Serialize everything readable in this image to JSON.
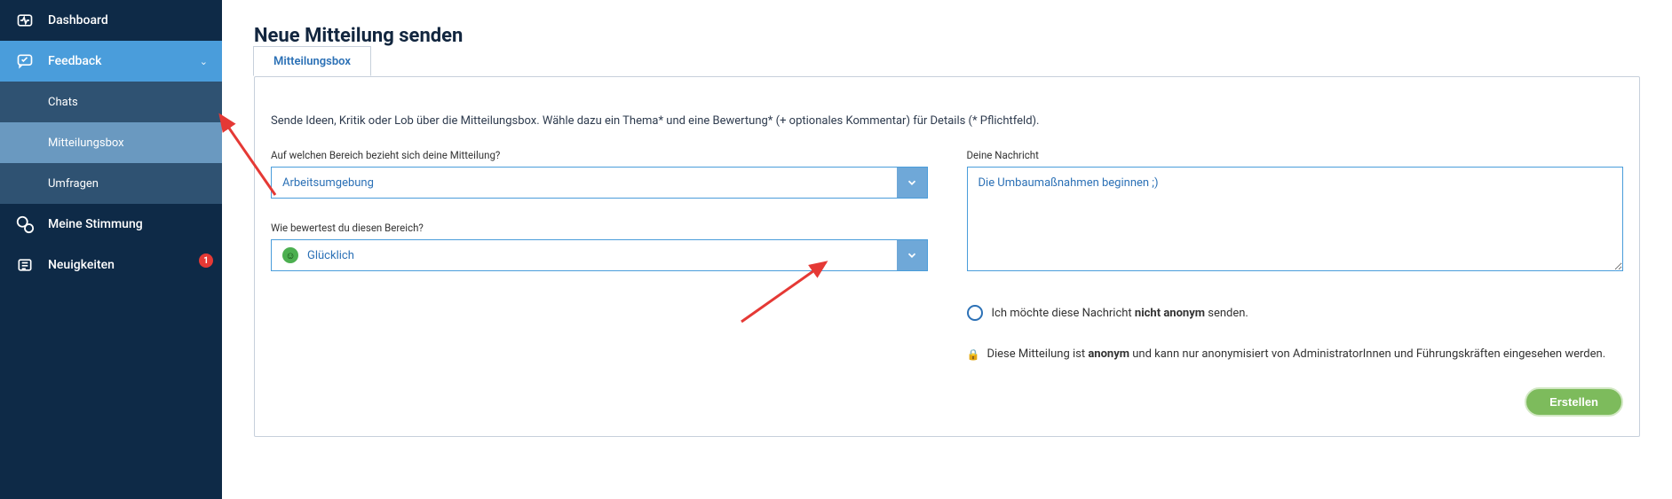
{
  "sidebar": {
    "dashboard": "Dashboard",
    "feedback": "Feedback",
    "chats": "Chats",
    "mitteilungsbox": "Mitteilungsbox",
    "umfragen": "Umfragen",
    "stimmung": "Meine Stimmung",
    "neuigkeiten": "Neuigkeiten",
    "badge": "1"
  },
  "page": {
    "title": "Neue Mitteilung senden",
    "tab": "Mitteilungsbox",
    "intro": "Sende Ideen, Kritik oder Lob über die Mitteilungsbox. Wähle dazu ein Thema* und eine Bewertung* (+ optionales Kommentar) für Details (* Pflichtfeld)."
  },
  "form": {
    "area_label": "Auf welchen Bereich bezieht sich deine Mitteilung?",
    "area_value": "Arbeitsumgebung",
    "rating_label": "Wie bewertest du diesen Bereich?",
    "rating_value": "Glücklich",
    "message_label": "Deine Nachricht",
    "message_value": "Die Umbaumaßnahmen beginnen ;)",
    "anon_prefix": "Ich möchte diese Nachricht ",
    "anon_bold": "nicht anonym",
    "anon_suffix": " senden.",
    "lock_prefix": "Diese Mitteilung ist ",
    "lock_bold": "anonym",
    "lock_suffix": " und kann nur anonymisiert von AdministratorInnen und Führungskräften eingesehen werden.",
    "submit": "Erstellen"
  }
}
